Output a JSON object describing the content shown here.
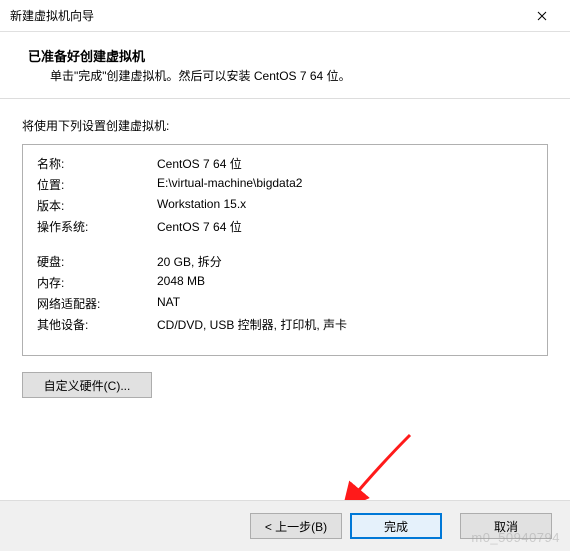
{
  "window": {
    "title": "新建虚拟机向导"
  },
  "header": {
    "title": "已准备好创建虚拟机",
    "subtitle": "单击\"完成\"创建虚拟机。然后可以安装 CentOS 7 64 位。"
  },
  "body": {
    "intro": "将使用下列设置创建虚拟机:",
    "rows1": {
      "name_label": "名称:",
      "name_value": "CentOS 7 64 位",
      "location_label": "位置:",
      "location_value": "E:\\virtual-machine\\bigdata2",
      "version_label": "版本:",
      "version_value": "Workstation 15.x",
      "os_label": "操作系统:",
      "os_value": "CentOS 7 64 位"
    },
    "rows2": {
      "disk_label": "硬盘:",
      "disk_value": "20 GB, 拆分",
      "memory_label": "内存:",
      "memory_value": "2048 MB",
      "net_label": "网络适配器:",
      "net_value": "NAT",
      "other_label": "其他设备:",
      "other_value": "CD/DVD, USB 控制器, 打印机, 声卡"
    },
    "customize_label": "自定义硬件(C)..."
  },
  "footer": {
    "back_label": "< 上一步(B)",
    "finish_label": "完成",
    "cancel_label": "取消"
  },
  "watermark": "m0_50940794"
}
